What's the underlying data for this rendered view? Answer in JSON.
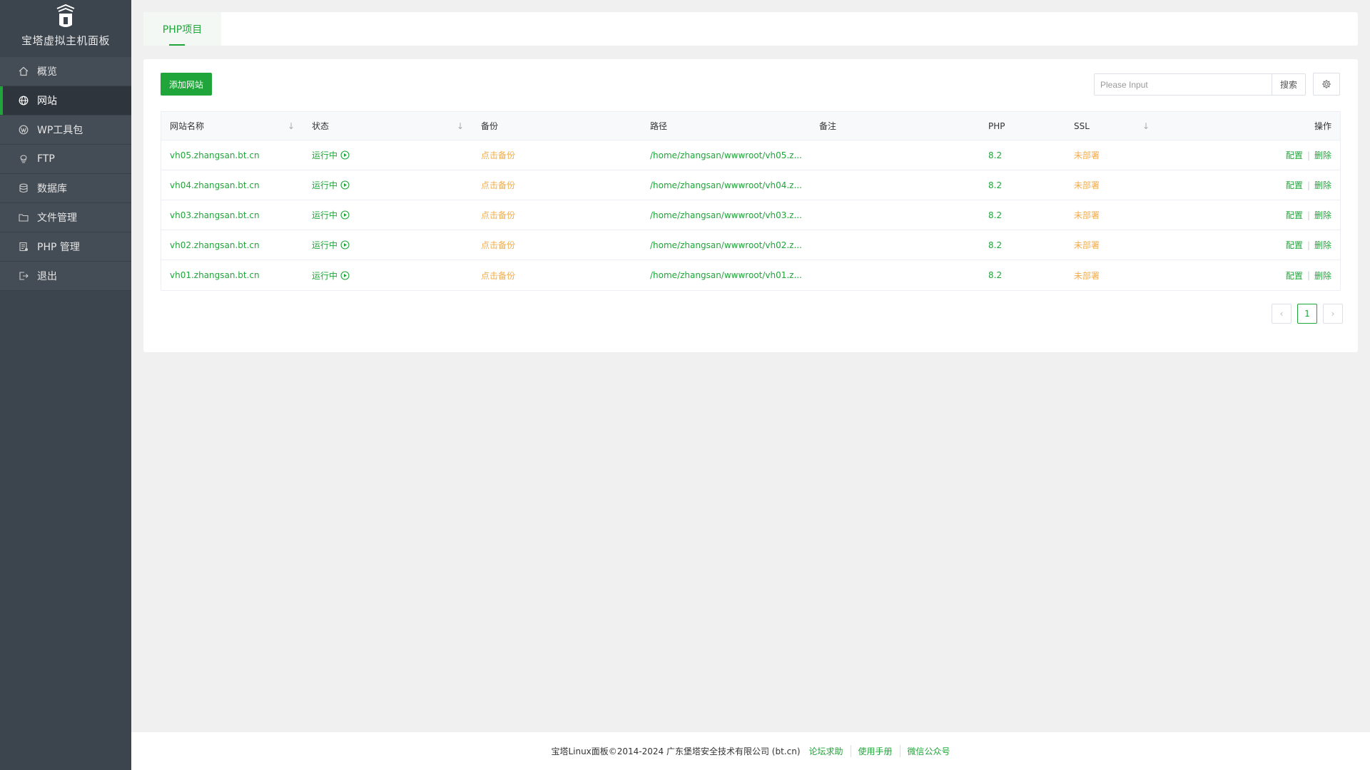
{
  "brand": {
    "name": "宝塔虚拟主机面板"
  },
  "sidebar": {
    "items": [
      {
        "label": "概览",
        "icon": "home-icon"
      },
      {
        "label": "网站",
        "icon": "globe-icon",
        "active": true
      },
      {
        "label": "WP工具包",
        "icon": "wordpress-icon"
      },
      {
        "label": "FTP",
        "icon": "ftp-icon"
      },
      {
        "label": "数据库",
        "icon": "database-icon"
      },
      {
        "label": "文件管理",
        "icon": "folder-icon"
      },
      {
        "label": "PHP 管理",
        "icon": "php-icon"
      },
      {
        "label": "退出",
        "icon": "logout-icon"
      }
    ]
  },
  "tabs": [
    {
      "label": "PHP项目",
      "active": true
    }
  ],
  "toolbar": {
    "add_label": "添加网站",
    "search_placeholder": "Please Input",
    "search_label": "搜索"
  },
  "table": {
    "headers": [
      "网站名称",
      "状态",
      "备份",
      "路径",
      "备注",
      "PHP",
      "SSL",
      "操作"
    ],
    "rows": [
      {
        "name": "vh05.zhangsan.bt.cn",
        "status": "运行中",
        "backup": "点击备份",
        "path": "/home/zhangsan/wwwroot/vh05.z...",
        "note": "",
        "php": "8.2",
        "ssl": "未部署",
        "op_config": "配置",
        "op_delete": "删除"
      },
      {
        "name": "vh04.zhangsan.bt.cn",
        "status": "运行中",
        "backup": "点击备份",
        "path": "/home/zhangsan/wwwroot/vh04.z...",
        "note": "",
        "php": "8.2",
        "ssl": "未部署",
        "op_config": "配置",
        "op_delete": "删除"
      },
      {
        "name": "vh03.zhangsan.bt.cn",
        "status": "运行中",
        "backup": "点击备份",
        "path": "/home/zhangsan/wwwroot/vh03.z...",
        "note": "",
        "php": "8.2",
        "ssl": "未部署",
        "op_config": "配置",
        "op_delete": "删除"
      },
      {
        "name": "vh02.zhangsan.bt.cn",
        "status": "运行中",
        "backup": "点击备份",
        "path": "/home/zhangsan/wwwroot/vh02.z...",
        "note": "",
        "php": "8.2",
        "ssl": "未部署",
        "op_config": "配置",
        "op_delete": "删除"
      },
      {
        "name": "vh01.zhangsan.bt.cn",
        "status": "运行中",
        "backup": "点击备份",
        "path": "/home/zhangsan/wwwroot/vh01.z...",
        "note": "",
        "php": "8.2",
        "ssl": "未部署",
        "op_config": "配置",
        "op_delete": "删除"
      }
    ]
  },
  "pagination": {
    "current": "1"
  },
  "footer": {
    "copyright": "宝塔Linux面板©2014-2024 广东堡塔安全技术有限公司 (bt.cn)",
    "links": [
      "论坛求助",
      "使用手册",
      "微信公众号"
    ]
  },
  "colors": {
    "accent": "#20a53a",
    "warning": "#f0ad4e",
    "sidebar": "#3c444d"
  }
}
